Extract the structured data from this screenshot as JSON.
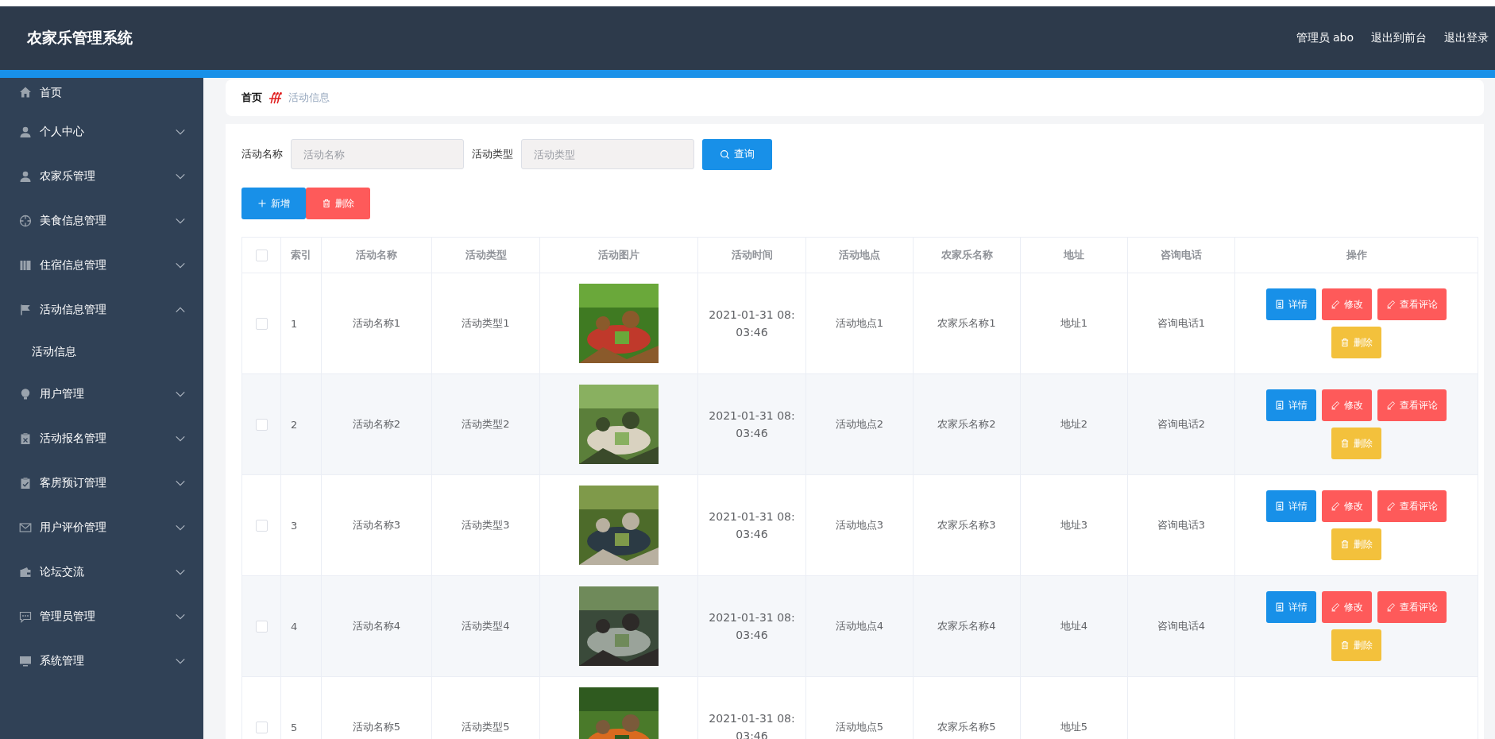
{
  "header": {
    "title": "农家乐管理系统",
    "links": [
      "管理员 abo",
      "退出到前台",
      "退出登录"
    ]
  },
  "sidebar": {
    "items": [
      {
        "label": "首页"
      },
      {
        "label": "个人中心",
        "expanded": false
      },
      {
        "label": "农家乐管理",
        "expanded": false
      },
      {
        "label": "美食信息管理",
        "expanded": false
      },
      {
        "label": "住宿信息管理",
        "expanded": false
      },
      {
        "label": "活动信息管理",
        "expanded": true,
        "children": [
          {
            "label": "活动信息"
          }
        ]
      },
      {
        "label": "用户管理",
        "expanded": false
      },
      {
        "label": "活动报名管理",
        "expanded": false
      },
      {
        "label": "客房预订管理",
        "expanded": false
      },
      {
        "label": "用户评价管理",
        "expanded": false
      },
      {
        "label": "论坛交流",
        "expanded": false
      },
      {
        "label": "管理员管理",
        "expanded": false
      },
      {
        "label": "系统管理",
        "expanded": false
      }
    ]
  },
  "breadcrumb": [
    "首页",
    "活动信息"
  ],
  "search": {
    "fields": [
      {
        "label": "活动名称",
        "placeholder": "活动名称"
      },
      {
        "label": "活动类型",
        "placeholder": "活动类型"
      }
    ],
    "button": "查询"
  },
  "toolbar": [
    {
      "kind": "add",
      "label": "新增"
    },
    {
      "kind": "delete",
      "label": "删除"
    }
  ],
  "table": {
    "select_all": {
      "checked": false
    },
    "columns": [
      "索引",
      "活动名称",
      "活动类型",
      "活动图片",
      "活动时间",
      "活动地点",
      "农家乐名称",
      "地址",
      "咨询电话",
      "操作"
    ],
    "rows": [
      {
        "checked": false,
        "cells": [
          "1",
          "活动名称1",
          "活动类型1",
          {
            "kind": "picture"
          },
          "2021-01-31 08:03:46",
          "活动地点1",
          "农家乐名称1",
          "地址1",
          "咨询电话1"
        ],
        "actions": [
          {
            "kind": "detail",
            "label": "详情"
          },
          {
            "kind": "edit",
            "label": "修改"
          },
          {
            "kind": "edit",
            "label": "查看评论"
          },
          {
            "kind": "delete",
            "label": "删除"
          }
        ]
      },
      {
        "checked": false,
        "cells": [
          "2",
          "活动名称2",
          "活动类型2",
          {
            "kind": "picture"
          },
          "2021-01-31 08:03:46",
          "活动地点2",
          "农家乐名称2",
          "地址2",
          "咨询电话2"
        ],
        "actions": [
          {
            "kind": "detail",
            "label": "详情"
          },
          {
            "kind": "edit",
            "label": "修改"
          },
          {
            "kind": "edit",
            "label": "查看评论"
          },
          {
            "kind": "delete",
            "label": "删除"
          }
        ]
      },
      {
        "checked": false,
        "cells": [
          "3",
          "活动名称3",
          "活动类型3",
          {
            "kind": "picture"
          },
          "2021-01-31 08:03:46",
          "活动地点3",
          "农家乐名称3",
          "地址3",
          "咨询电话3"
        ],
        "actions": [
          {
            "kind": "detail",
            "label": "详情"
          },
          {
            "kind": "edit",
            "label": "修改"
          },
          {
            "kind": "edit",
            "label": "查看评论"
          },
          {
            "kind": "delete",
            "label": "删除"
          }
        ]
      },
      {
        "checked": false,
        "cells": [
          "4",
          "活动名称4",
          "活动类型4",
          {
            "kind": "picture"
          },
          "2021-01-31 08:03:46",
          "活动地点4",
          "农家乐名称4",
          "地址4",
          "咨询电话4"
        ],
        "actions": [
          {
            "kind": "detail",
            "label": "详情"
          },
          {
            "kind": "edit",
            "label": "修改"
          },
          {
            "kind": "edit",
            "label": "查看评论"
          },
          {
            "kind": "delete",
            "label": "删除"
          }
        ]
      },
      {
        "checked": false,
        "cells": [
          "5",
          "活动名称5",
          "活动类型5",
          {
            "kind": "picture"
          },
          "2021-01-31 08:03:46",
          "活动地点5",
          "农家乐名称5",
          "地址5"
        ],
        "actions": []
      }
    ]
  }
}
